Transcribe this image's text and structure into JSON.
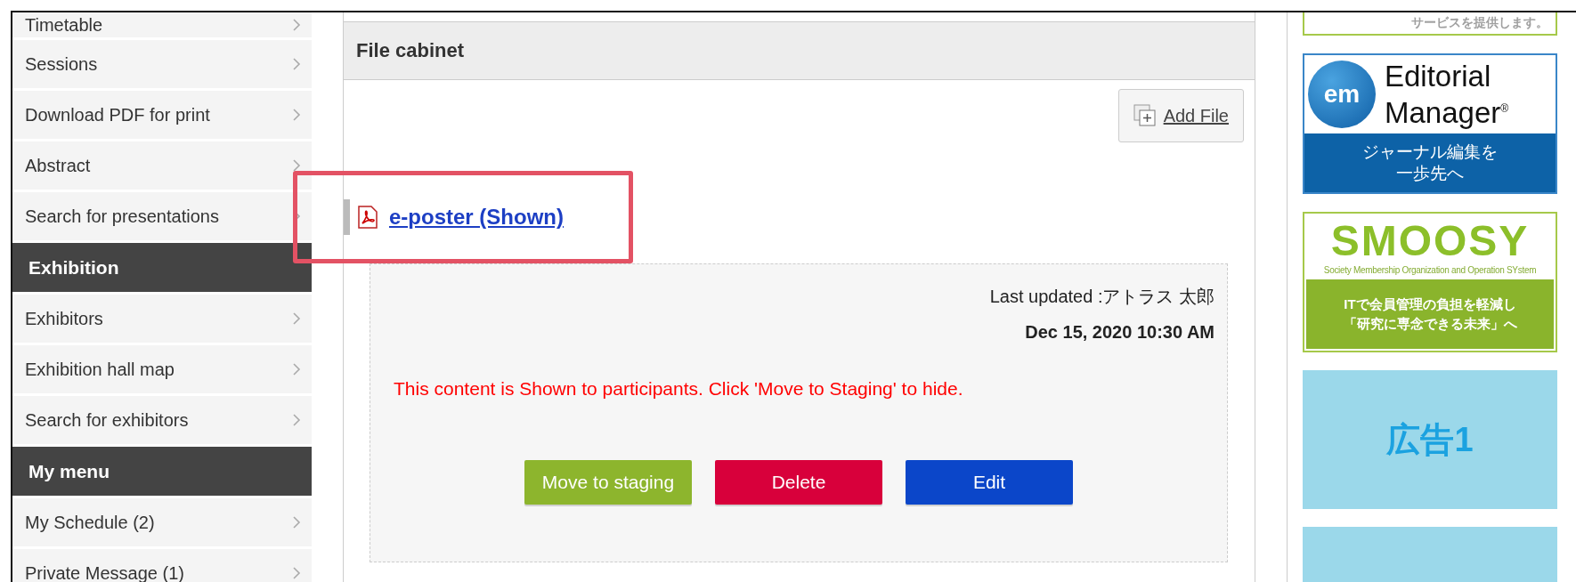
{
  "sidebar": [
    {
      "kind": "item",
      "label": "Timetable"
    },
    {
      "kind": "item",
      "label": "Sessions"
    },
    {
      "kind": "item",
      "label": "Download PDF for print"
    },
    {
      "kind": "item",
      "label": "Abstract"
    },
    {
      "kind": "item",
      "label": "Search for presentations"
    },
    {
      "kind": "header",
      "label": "Exhibition"
    },
    {
      "kind": "item",
      "label": "Exhibitors"
    },
    {
      "kind": "item",
      "label": "Exhibition hall map"
    },
    {
      "kind": "item",
      "label": "Search for exhibitors"
    },
    {
      "kind": "header",
      "label": "My menu"
    },
    {
      "kind": "item",
      "label": "My Schedule (2)"
    },
    {
      "kind": "item",
      "label": "Private Message (1)"
    }
  ],
  "panel": {
    "title": "File cabinet",
    "add_button": "Add File",
    "file": {
      "label": "e-poster (Shown)",
      "highlighted": true
    },
    "last_updated": "Last updated :アトラス 太郎",
    "date": "Dec 15, 2020 10:30 AM",
    "notice": "This content is Shown to participants. Click 'Move to Staging' to hide.",
    "actions": [
      {
        "kind": "stage",
        "label": "Move to staging"
      },
      {
        "kind": "delete",
        "label": "Delete"
      },
      {
        "kind": "edit",
        "label": "Edit"
      }
    ]
  },
  "ads": [
    {
      "kind": "tail",
      "text": "サービスを提供します。"
    },
    {
      "kind": "editorial",
      "badge": "em",
      "title_lines": [
        "Editorial",
        "Manager"
      ],
      "mark": "®",
      "caption_lines": [
        "ジャーナル編集を",
        "一歩先へ"
      ]
    },
    {
      "kind": "smoosy",
      "logo": "SMOOSY",
      "tagline": "Society Membership Organization and Operation SYstem",
      "caption_lines": [
        "ITで会員管理の負担を軽減し",
        "「研究に専念できる未来」へ"
      ]
    },
    {
      "kind": "placeholder",
      "text": "広告1"
    },
    {
      "kind": "blank"
    }
  ]
}
